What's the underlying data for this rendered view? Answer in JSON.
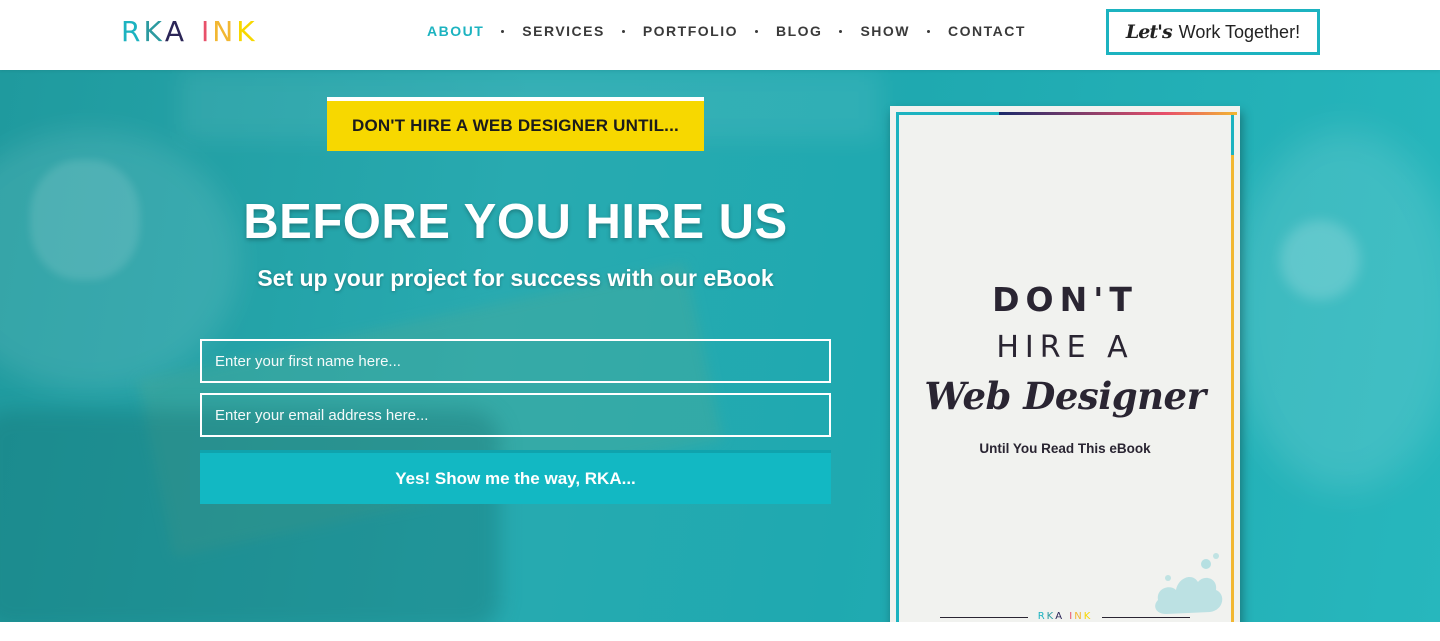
{
  "brand": {
    "logo_letters": [
      {
        "ch": "R",
        "color": "#1cb3c0"
      },
      {
        "ch": "K",
        "color": "#2c9aa0"
      },
      {
        "ch": "A",
        "color": "#2b2557"
      },
      {
        "ch": " ",
        "color": "#ffffff"
      },
      {
        "ch": "I",
        "color": "#e8506a"
      },
      {
        "ch": "N",
        "color": "#f2b732"
      },
      {
        "ch": "K",
        "color": "#f7d800"
      }
    ]
  },
  "nav": {
    "items": [
      {
        "label": "ABOUT",
        "active": true
      },
      {
        "label": "SERVICES",
        "active": false
      },
      {
        "label": "PORTFOLIO",
        "active": false
      },
      {
        "label": "BLOG",
        "active": false
      },
      {
        "label": "SHOW",
        "active": false
      },
      {
        "label": "CONTACT",
        "active": false
      }
    ]
  },
  "cta": {
    "script": "Let's",
    "text": "Work Together!"
  },
  "hero": {
    "tag": "DON'T HIRE A WEB DESIGNER UNTIL...",
    "headline": "BEFORE YOU HIRE US",
    "subhead": "Set up your project for success with our eBook",
    "name_placeholder": "Enter your first name here...",
    "email_placeholder": "Enter your email address here...",
    "submit_label": "Yes! Show me the way, RKA..."
  },
  "book": {
    "line1": "DON'T",
    "line2": "HIRE A",
    "line3": "Web Designer",
    "line4": "Until You Read This eBook",
    "logo_text": "RKA INK"
  },
  "colors": {
    "accent": "#1cb3c0",
    "tag_yellow": "#f7d800",
    "dark_text": "#3a3a3a"
  }
}
